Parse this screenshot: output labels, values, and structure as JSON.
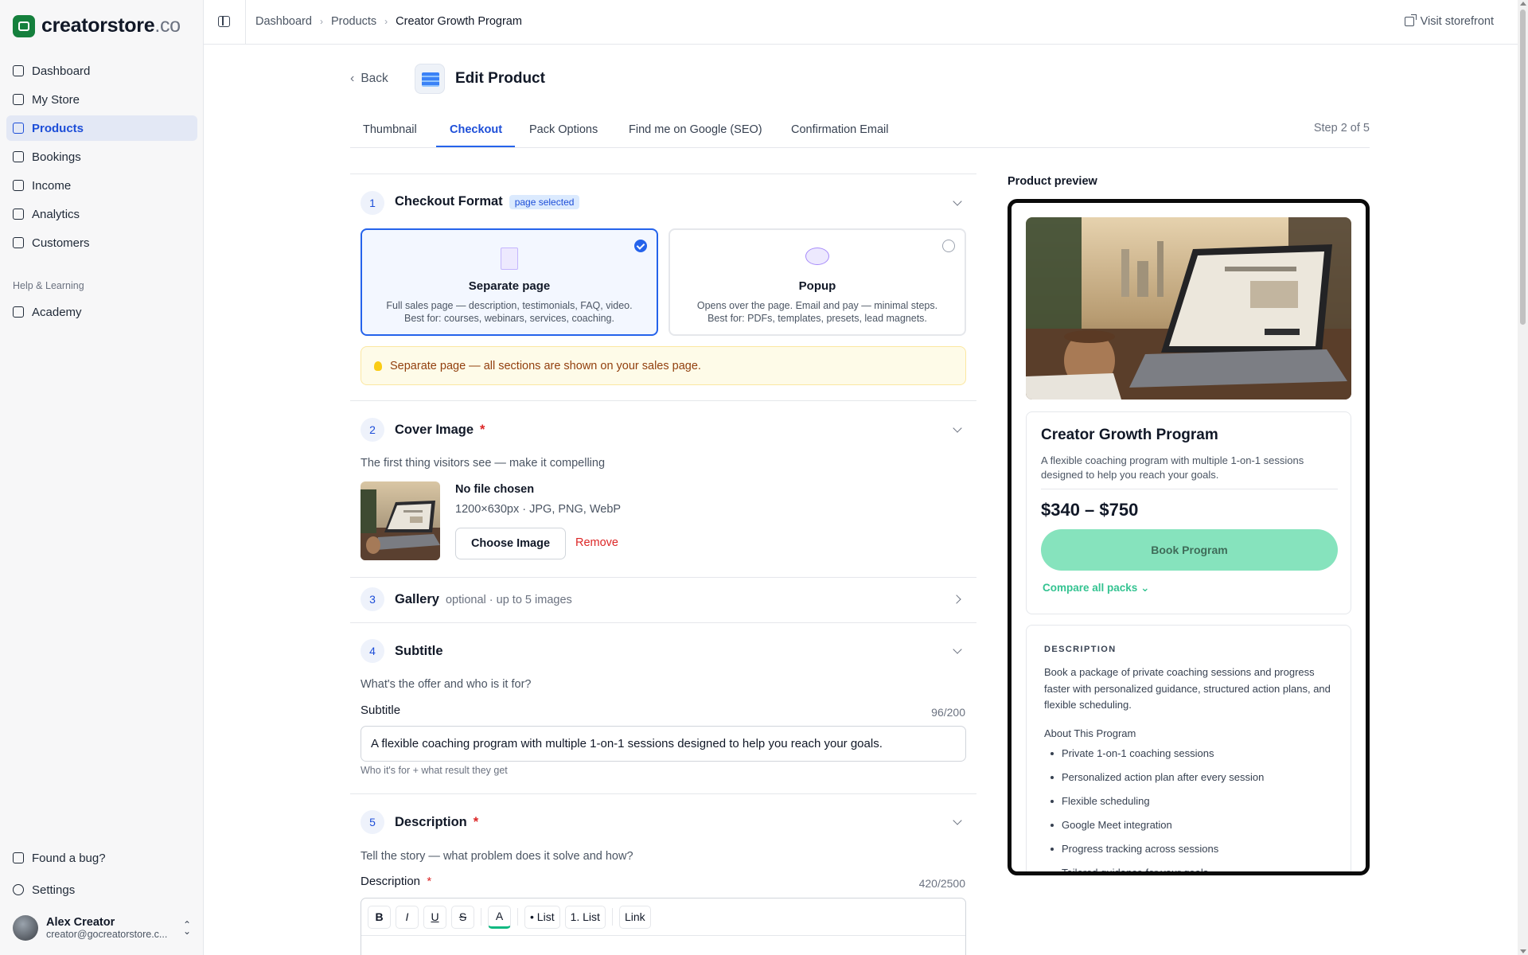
{
  "brand": {
    "name": "creatorstore",
    "suffix": ".co"
  },
  "sidebar": {
    "items": [
      {
        "label": "Dashboard",
        "icon": "dashboard-icon"
      },
      {
        "label": "My Store",
        "icon": "store-icon"
      },
      {
        "label": "Products",
        "icon": "package-icon",
        "active": true
      },
      {
        "label": "Bookings",
        "icon": "calendar-icon"
      },
      {
        "label": "Income",
        "icon": "wallet-icon"
      },
      {
        "label": "Analytics",
        "icon": "bar-chart-icon"
      },
      {
        "label": "Customers",
        "icon": "users-icon"
      }
    ],
    "section_label": "Help & Learning",
    "help_items": [
      {
        "label": "Academy",
        "icon": "graduation-cap-icon"
      }
    ],
    "bottom_items": [
      {
        "label": "Found a bug?",
        "icon": "bug-report-icon"
      },
      {
        "label": "Settings",
        "icon": "gear-icon"
      }
    ],
    "user": {
      "name": "Alex Creator",
      "email": "creator@gocreatorstore.c..."
    }
  },
  "topbar": {
    "breadcrumb": [
      "Dashboard",
      "Products",
      "Creator Growth Program"
    ],
    "visit_label": "Visit storefront"
  },
  "header": {
    "back_label": "Back",
    "title": "Edit Product"
  },
  "tabs": {
    "items": [
      "Thumbnail",
      "Checkout",
      "Pack Options",
      "Find me on Google (SEO)",
      "Confirmation Email"
    ],
    "active": "Checkout",
    "step_label": "Step 2 of 5"
  },
  "sections": {
    "checkout_format": {
      "number": "1",
      "title": "Checkout Format",
      "badge": "page selected",
      "options": [
        {
          "title": "Separate page",
          "desc1": "Full sales page — description, testimonials, FAQ, video.",
          "desc2": "Best for: courses, webinars, services, coaching.",
          "selected": true
        },
        {
          "title": "Popup",
          "desc1": "Opens over the page. Email and pay — minimal steps.",
          "desc2": "Best for: PDFs, templates, presets, lead magnets.",
          "selected": false
        }
      ],
      "tip": "Separate page — all sections are shown on your sales page."
    },
    "cover_image": {
      "number": "2",
      "title": "Cover Image",
      "required": "*",
      "helper": "The first thing visitors see — make it compelling",
      "file_status": "No file chosen",
      "file_spec": "1200×630px · JPG, PNG, WebP",
      "choose_label": "Choose Image",
      "remove_label": "Remove"
    },
    "gallery": {
      "number": "3",
      "title": "Gallery",
      "note": "optional · up to 5 images"
    },
    "subtitle": {
      "number": "4",
      "title": "Subtitle",
      "helper": "What's the offer and who is it for?",
      "field_label": "Subtitle",
      "counter": "96/200",
      "value": "A flexible coaching program with multiple 1-on-1 sessions designed to help you reach your goals.",
      "hint": "Who it's for + what result they get"
    },
    "description": {
      "number": "5",
      "title": "Description",
      "required": "*",
      "helper": "Tell the story — what problem does it solve and how?",
      "field_label": "Description",
      "counter": "420/2500",
      "toolbar": [
        "B",
        "I",
        "U",
        "S",
        "A",
        "• List",
        "1. List",
        "Link"
      ]
    }
  },
  "preview": {
    "label": "Product preview",
    "title": "Creator Growth Program",
    "subtitle": "A flexible coaching program with multiple 1-on-1 sessions designed to help you reach your goals.",
    "price": "$340 – $750",
    "button": "Book Program",
    "compare": "Compare all packs",
    "desc_heading": "DESCRIPTION",
    "desc_text": "Book a package of private coaching sessions and progress faster with personalized guidance, structured action plans, and flexible scheduling.",
    "about": "About This Program",
    "bullets": [
      "Private 1-on-1 coaching sessions",
      "Personalized action plan after every session",
      "Flexible scheduling",
      "Google Meet integration",
      "Progress tracking across sessions",
      "Tailored guidance for your goals"
    ]
  },
  "colors": {
    "accent": "#2563eb",
    "brand_green": "#15803d",
    "cta_mint": "#86e3bd",
    "danger": "#dc2626"
  }
}
